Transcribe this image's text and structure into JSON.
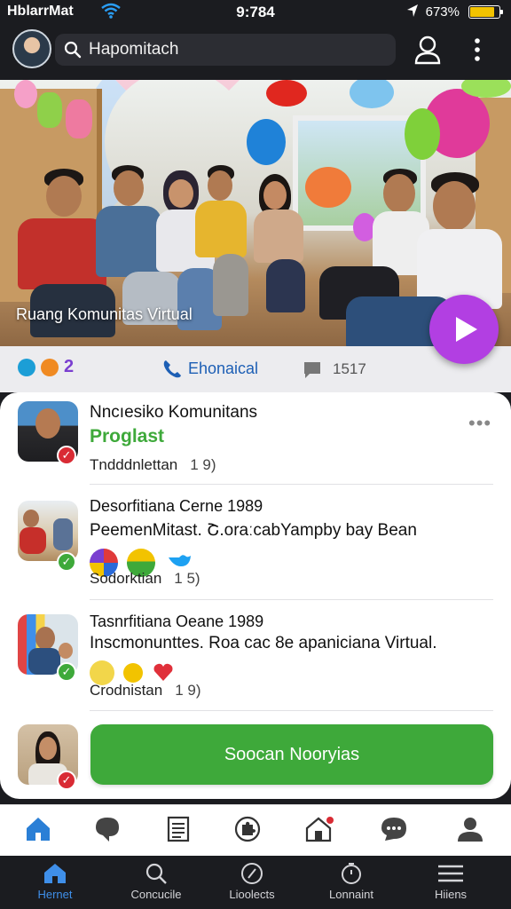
{
  "status_bar": {
    "carrier": "HblarrMat",
    "time": "9:784",
    "battery_pct": "673%",
    "battery_level": 0.85,
    "battery_color": "#f2c300"
  },
  "top_bar": {
    "search_text": "Hapomitach",
    "icons": [
      "search-icon",
      "profile-icon",
      "more-vertical-icon"
    ]
  },
  "hero": {
    "caption": "Ruang Komunitas Virtual"
  },
  "meta_bar": {
    "count": "2",
    "phone_label": "Ehonaical",
    "comment_count": "1517"
  },
  "feed": {
    "items": [
      {
        "title": "Nncıesiko Komunitans",
        "subtitle": "Proglast",
        "footer_label": "Tndddnlettan",
        "footer_num": "1 9)"
      },
      {
        "title": "Desorfitiana Cerne 1989",
        "subtitle": "PeemenMitast. Շ.oraːcabYampby bay Bean",
        "footer_label": "Sodorktian",
        "footer_num": "1 5)"
      },
      {
        "title": "Tasnrfitiana Oeane 1989",
        "subtitle": "Inscmonunttes. Roa cac 8e apaniciana Virtual.",
        "footer_label": "Crodnistan",
        "footer_num": "1 9)"
      }
    ],
    "cta_label": "Soocan Nooryias"
  },
  "bottom_nav": {
    "items": [
      {
        "label": "Hernet"
      },
      {
        "label": "Concucile"
      },
      {
        "label": "Lioolects"
      },
      {
        "label": "Lonnaint"
      },
      {
        "label": "Hiiens"
      }
    ]
  },
  "colors": {
    "accent_blue": "#3f8fe9",
    "cta_green": "#3ea93a",
    "play_purple": "#b23fe2",
    "proglast_green": "#3ea93a"
  }
}
